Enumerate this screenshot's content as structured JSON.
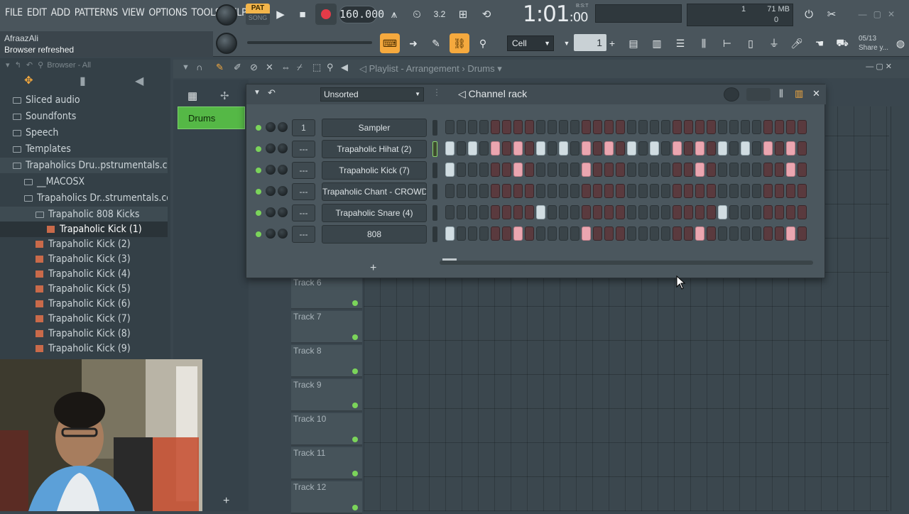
{
  "menu": [
    "FILE",
    "EDIT",
    "ADD",
    "PATTERNS",
    "VIEW",
    "OPTIONS",
    "TOOLS",
    "HELP"
  ],
  "hint": {
    "line1": "AfraazAli",
    "line2": "Browser refreshed"
  },
  "transport": {
    "pat": "PAT",
    "song": "SONG",
    "tempo": "160.000",
    "time_main": "1:01",
    "time_sub": ":00",
    "time_tag": "B:S:T"
  },
  "monitor": {
    "top_value": "1",
    "memory": "71 MB",
    "bottom_value": "0"
  },
  "toolbar2": {
    "snap": "Cell",
    "step_value": "1",
    "date": "05/13",
    "share": "Share y..."
  },
  "browser": {
    "header": "Browser - All",
    "items": [
      {
        "label": "Sliced audio",
        "kind": "folder",
        "indent": 0
      },
      {
        "label": "Soundfonts",
        "kind": "folder",
        "indent": 0
      },
      {
        "label": "Speech",
        "kind": "folder",
        "indent": 0
      },
      {
        "label": "Templates",
        "kind": "folder",
        "indent": 0
      },
      {
        "label": "Trapaholics Dru..pstrumentals.com)",
        "kind": "folder",
        "indent": 0
      },
      {
        "label": "__MACOSX",
        "kind": "folder",
        "indent": 1
      },
      {
        "label": "Trapaholics Dr..strumentals.com)",
        "kind": "folder",
        "indent": 1
      },
      {
        "label": "Trapaholic 808 Kicks",
        "kind": "folder",
        "indent": 2
      },
      {
        "label": "Trapaholic Kick (1)",
        "kind": "wav",
        "indent": 3
      },
      {
        "label": "Trapaholic Kick (2)",
        "kind": "wav",
        "indent": 2
      },
      {
        "label": "Trapaholic Kick (3)",
        "kind": "wav",
        "indent": 2
      },
      {
        "label": "Trapaholic Kick (4)",
        "kind": "wav",
        "indent": 2
      },
      {
        "label": "Trapaholic Kick (5)",
        "kind": "wav",
        "indent": 2
      },
      {
        "label": "Trapaholic Kick (6)",
        "kind": "wav",
        "indent": 2
      },
      {
        "label": "Trapaholic Kick (7)",
        "kind": "wav",
        "indent": 2
      },
      {
        "label": "Trapaholic Kick (8)",
        "kind": "wav",
        "indent": 2
      },
      {
        "label": "Trapaholic Kick (9)",
        "kind": "wav",
        "indent": 2
      }
    ]
  },
  "playlist": {
    "title": "Playlist - Arrangement",
    "pattern_name": "Drums",
    "tracks": [
      "Track 6",
      "Track 7",
      "Track 8",
      "Track 9",
      "Track 10",
      "Track 11",
      "Track 12"
    ]
  },
  "channel_rack": {
    "title": "Channel rack",
    "filter": "Unsorted",
    "add_label": "+",
    "channels": [
      {
        "name": "Sampler",
        "mixer": "1",
        "selected": false,
        "steps": []
      },
      {
        "name": "Trapaholic Hihat (2)",
        "mixer": "---",
        "selected": true,
        "steps": [
          0,
          2,
          4,
          6,
          8,
          10,
          12,
          14,
          16,
          18,
          20,
          22,
          24,
          26,
          28,
          30
        ]
      },
      {
        "name": "Trapaholic Kick (7)",
        "mixer": "---",
        "selected": false,
        "steps": [
          0,
          6,
          12,
          22,
          30
        ]
      },
      {
        "name": "Trapaholic Chant - CROWD",
        "mixer": "---",
        "selected": false,
        "steps": []
      },
      {
        "name": "Trapaholic Snare (4)",
        "mixer": "---",
        "selected": false,
        "steps": [
          8,
          24
        ]
      },
      {
        "name": "808",
        "mixer": "---",
        "selected": false,
        "steps": [
          0,
          6,
          12,
          22,
          30
        ]
      }
    ]
  },
  "colors": {
    "accent": "#f5a93e",
    "pattern": "#55b846",
    "led": "#7bd45a",
    "record": "#e33b48"
  }
}
